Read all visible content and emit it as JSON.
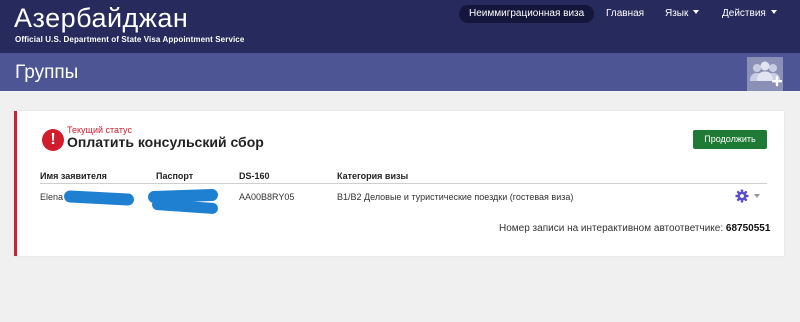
{
  "header": {
    "title": "Азербайджан",
    "subtitle": "Official U.S. Department of State Visa Appointment Service",
    "nav": {
      "visa_type": "Неиммиграционная виза",
      "home": "Главная",
      "language": "Язык",
      "actions": "Действия"
    }
  },
  "page": {
    "title": "Группы",
    "add_group_icon": "add-group-icon"
  },
  "status": {
    "label": "Текущий статус",
    "value": "Оплатить консульский сбор",
    "icon": "exclamation-icon",
    "continue_button": "Продолжить"
  },
  "table": {
    "columns": [
      "Имя заявителя",
      "Паспорт",
      "DS-160",
      "Категория визы"
    ],
    "rows": [
      {
        "name": "Elena",
        "passport": "",
        "ds160": "AA00B8RY05",
        "category": "B1/B2 Деловые и туристические поездки (гостевая виза)",
        "actions_icon": "gear-icon"
      }
    ]
  },
  "ivr": {
    "label": "Номер записи на интерактивном автоответчике:",
    "value": "68750551"
  },
  "colors": {
    "header_bg": "#272a5c",
    "subheader_bg": "#4d5594",
    "status_red": "#cf1d2e",
    "continue_green": "#1f7a35",
    "gear_purple": "#5b4fc9",
    "redaction_blue": "#1f7fd0"
  }
}
